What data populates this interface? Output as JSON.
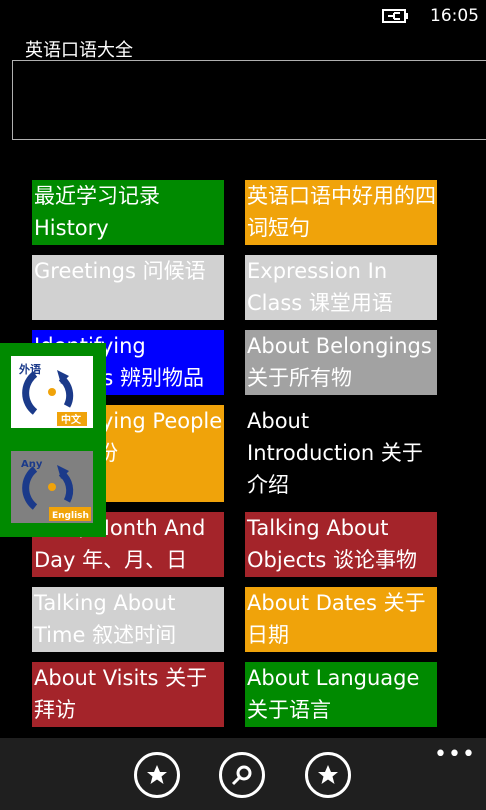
{
  "status": {
    "time": "16:05"
  },
  "app": {
    "title": "英语口语大全",
    "search_value": ""
  },
  "tiles": [
    {
      "label": "最近学习记录 History"
    },
    {
      "label": "英语口语中好用的四词短句"
    },
    {
      "label": " Greetings 问候语"
    },
    {
      "label": "Expression In Class 课堂用语"
    },
    {
      "label": "Identifying Objects 辨别物品"
    },
    {
      "label": "About Belongings 关于所有物"
    },
    {
      "label": "Identifying People 辨别身份"
    },
    {
      "label": " About Introduction 关于介绍"
    },
    {
      "label": "Year, Month And Day 年、月、日"
    },
    {
      "label": "Talking About Objects 谈论事物"
    },
    {
      "label": "Talking About Time 叙述时间"
    },
    {
      "label": "About Dates 关于日期"
    },
    {
      "label": "About Visits 关于拜访"
    },
    {
      "label": "About Language 关于语言"
    }
  ],
  "language_switch": {
    "option1": {
      "top": "外语",
      "bottom": "中文"
    },
    "option2": {
      "top": "Any",
      "bottom": "English"
    }
  },
  "appbar": {
    "more": "•••"
  },
  "colors": {
    "green": "#008a00",
    "orange": "#f0a30a",
    "light": "#d1d1d1",
    "blue": "#0000ff",
    "gray": "#a2a2a2",
    "red": "#a4242a"
  }
}
